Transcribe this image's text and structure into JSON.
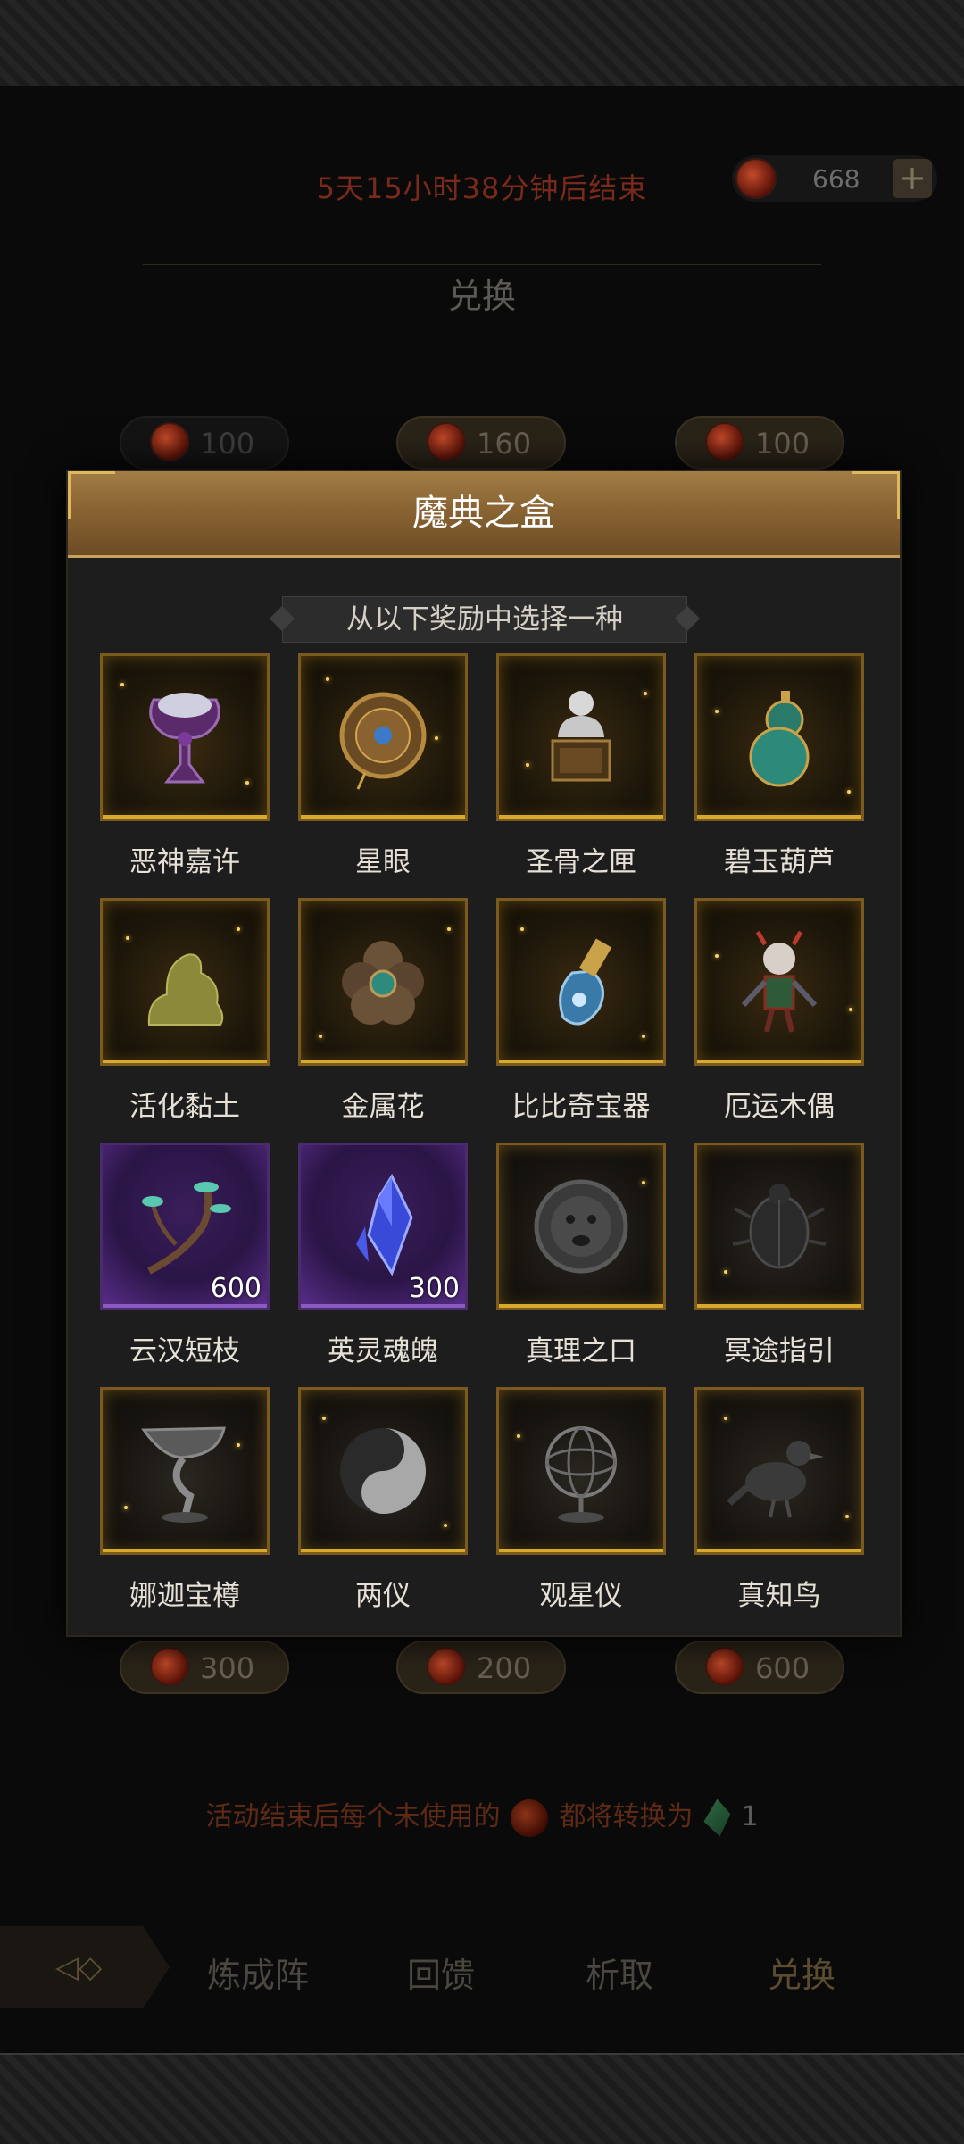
{
  "event": {
    "countdown": "5天15小时38分钟后结束",
    "currency_value": "668",
    "currency_icon": "red-gem-icon",
    "section_title": "兑换"
  },
  "behind_costs": {
    "top": [
      "100",
      "160",
      "100"
    ],
    "bottom": [
      "300",
      "200",
      "600"
    ]
  },
  "modal": {
    "title": "魔典之盒",
    "subtitle": "从以下奖励中选择一种",
    "rewards": [
      {
        "name": "恶神嘉许",
        "icon": "chalice-icon"
      },
      {
        "name": "星眼",
        "icon": "eye-shield-icon"
      },
      {
        "name": "圣骨之匣",
        "icon": "bust-reliquary-icon"
      },
      {
        "name": "碧玉葫芦",
        "icon": "gourd-icon"
      },
      {
        "name": "活化黏土",
        "icon": "clay-icon"
      },
      {
        "name": "金属花",
        "icon": "metal-flower-icon"
      },
      {
        "name": "比比奇宝器",
        "icon": "vial-icon"
      },
      {
        "name": "厄运木偶",
        "icon": "puppet-icon"
      },
      {
        "name": "云汉短枝",
        "icon": "branch-icon",
        "count": "600"
      },
      {
        "name": "英灵魂魄",
        "icon": "crystal-icon",
        "count": "300"
      },
      {
        "name": "真理之口",
        "icon": "stone-face-icon"
      },
      {
        "name": "冥途指引",
        "icon": "scarab-icon"
      },
      {
        "name": "娜迦宝樽",
        "icon": "goblet-icon"
      },
      {
        "name": "两仪",
        "icon": "yin-yang-icon"
      },
      {
        "name": "观星仪",
        "icon": "armillary-icon"
      },
      {
        "name": "真知鸟",
        "icon": "bird-icon"
      }
    ]
  },
  "conversion_note": {
    "before": "活动结束后每个未使用的",
    "after": "都将转换为",
    "count": "1"
  },
  "tabs": [
    "炼成阵",
    "回馈",
    "析取",
    "兑换"
  ],
  "active_tab": "兑换"
}
